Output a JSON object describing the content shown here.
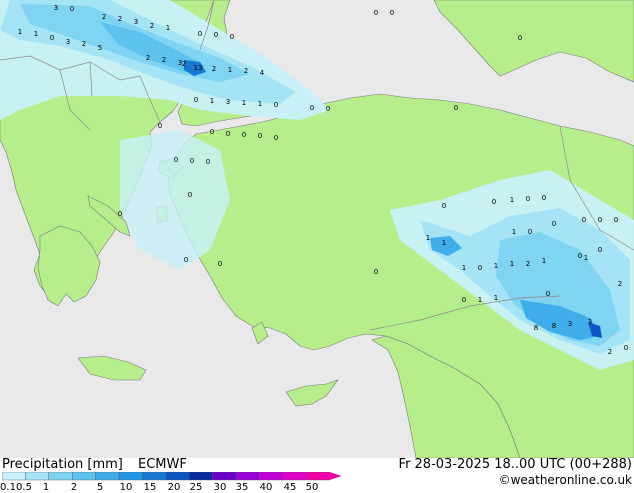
{
  "colors": {
    "sea": "#e9e9e9",
    "land": "#b7ee8c",
    "border": "#8a8a8a",
    "coast": "#7a7a7a"
  },
  "legend": {
    "title": "Precipitation [mm]",
    "model": "ECMWF",
    "ticks": [
      "0.1",
      "0.5",
      "1",
      "2",
      "5",
      "10",
      "15",
      "20",
      "25",
      "30",
      "35",
      "40",
      "45",
      "50"
    ],
    "colors": [
      "#c8f0fa",
      "#a4e4f6",
      "#7fd4f2",
      "#5ec2ee",
      "#3fadea",
      "#2296e2",
      "#1778d4",
      "#0b57c4",
      "#0c2a9e",
      "#6a00c8",
      "#9a00d8",
      "#c400d8",
      "#e000c8",
      "#f000a8"
    ]
  },
  "valid_time": "Fr 28-03-2025 18..00 UTC (00+288)",
  "credit": "©weatheronline.co.uk",
  "map_values": [
    "3",
    "0",
    "2",
    "2",
    "3",
    "2",
    "1",
    "0",
    "0",
    "0",
    "1",
    "1",
    "0",
    "3",
    "2",
    "5",
    "2",
    "2",
    "3",
    "2",
    "13",
    "2",
    "1",
    "2",
    "4",
    "0",
    "1",
    "3",
    "1",
    "1",
    "0",
    "0",
    "0",
    "0",
    "0",
    "0",
    "0",
    "0",
    "0",
    "0",
    "0",
    "0",
    "0",
    "0",
    "0",
    "0",
    "0",
    "0",
    "0",
    "0",
    "0",
    "0",
    "1",
    "0",
    "0",
    "0",
    "1",
    "1",
    "0",
    "0",
    "0",
    "1",
    "0",
    "0",
    "0",
    "1",
    "0",
    "1",
    "2",
    "1",
    "1",
    "0",
    "1",
    "2",
    "0",
    "1",
    "1",
    "8",
    "8",
    "3",
    "3",
    "2",
    "0",
    "0"
  ]
}
